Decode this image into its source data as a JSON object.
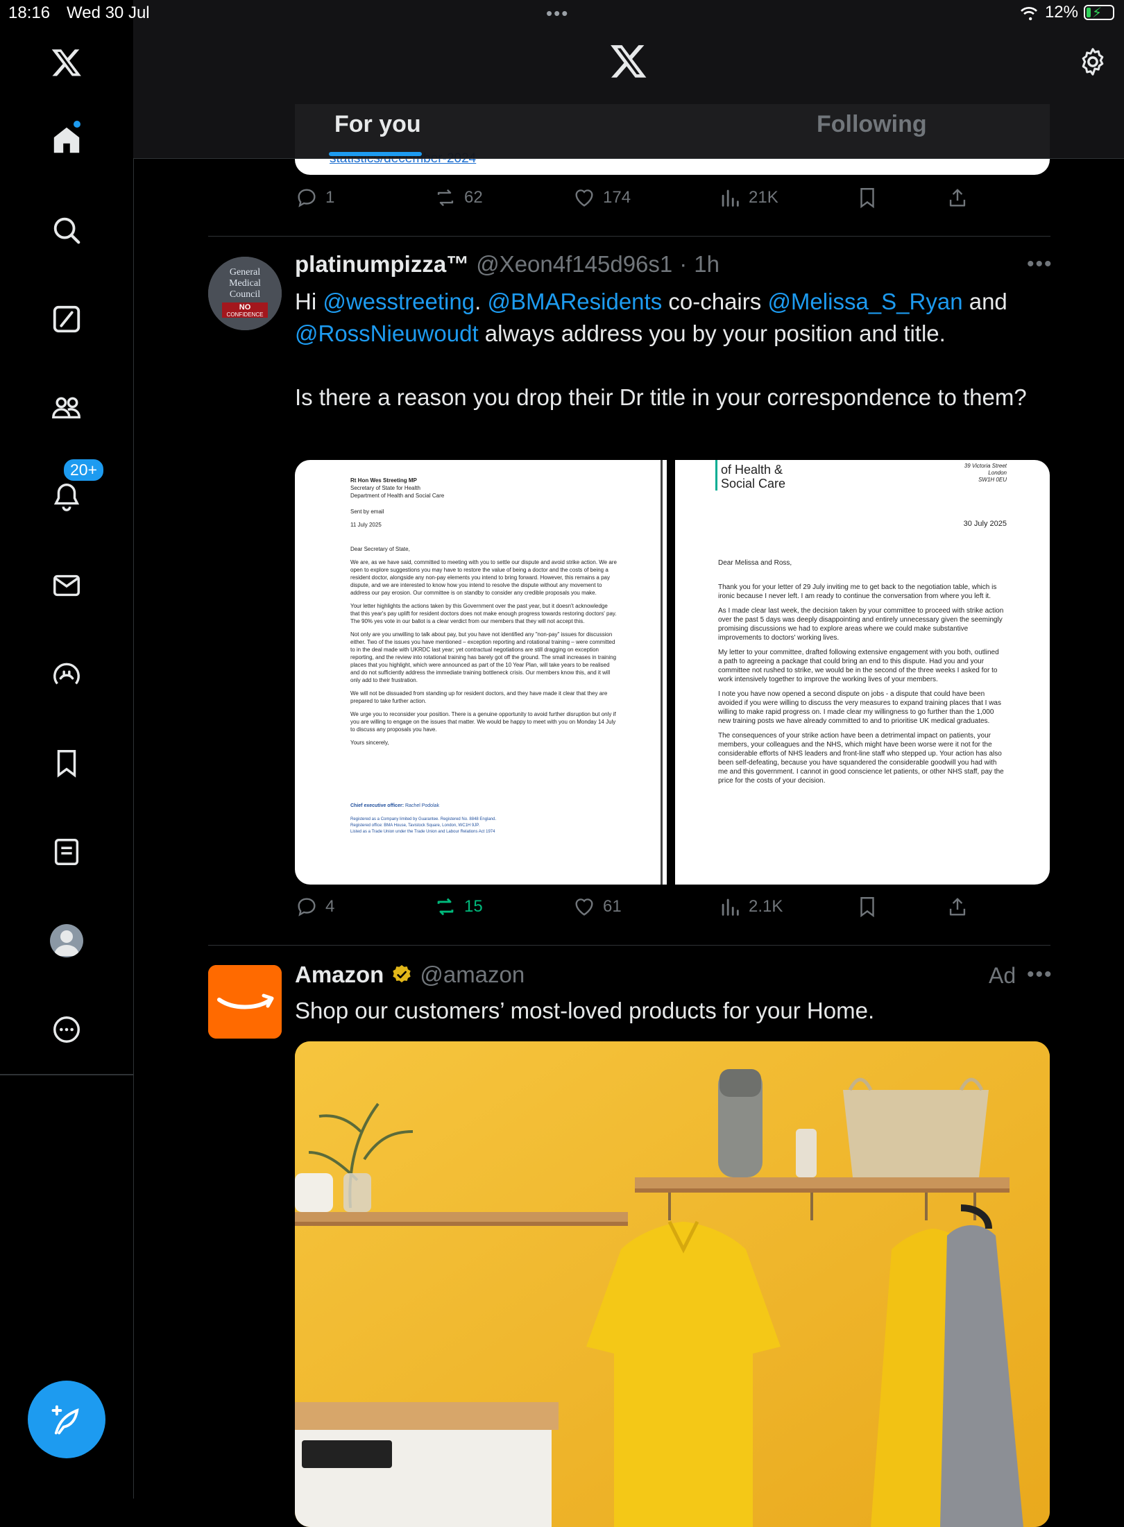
{
  "status_bar": {
    "time": "18:16",
    "date": "Wed 30 Jul",
    "battery": "12%"
  },
  "sidebar": {
    "notif_badge": "20+",
    "items": [
      "home",
      "explore",
      "grok",
      "communities",
      "notifications",
      "messages",
      "spaces",
      "bookmarks",
      "lists",
      "profile",
      "more"
    ]
  },
  "topbar": {
    "tab_foryou": "For you",
    "tab_following": "Following"
  },
  "prev_tweet": {
    "link": "statistics/december-2024",
    "replies": "1",
    "reposts": "62",
    "likes": "174",
    "views": "21K"
  },
  "tweet1": {
    "avatar_text": [
      "General",
      "Medical",
      "Council",
      "NO",
      "CONFIDENCE"
    ],
    "name": "platinumpizza™",
    "handle": "@Xeon4f145d96s1",
    "sep": "·",
    "time": "1h",
    "t1": "Hi ",
    "m1": "@wesstreeting",
    "t2": ". ",
    "m2": "@BMAResidents",
    "t3": " co-chairs ",
    "m3": "@Melissa_S_Ryan",
    "t4": " and ",
    "m4": "@RossNieuwoudt",
    "t5": " always address you by your position and title.",
    "p2": "Is there a reason you drop their Dr title in your correspondence to them?",
    "replies": "4",
    "reposts": "15",
    "likes": "61",
    "views": "2.1K",
    "doc_left": {
      "addressee": [
        "Rt Hon Wes Streeting MP",
        "Secretary of State for Health",
        "Department of Health and Social Care"
      ],
      "sent": "Sent by email",
      "date": "11 July 2025",
      "greeting": "Dear Secretary of State,",
      "paras": [
        "We are, as we have said, committed to meeting with you to settle our dispute and avoid strike action. We are open to explore suggestions you may have to restore the value of being a doctor and the costs of being a resident doctor, alongside any non-pay elements you intend to bring forward. However, this remains a pay dispute, and we are interested to know how you intend to resolve the dispute without any movement to address our pay erosion. Our committee is on standby to consider any credible proposals you make.",
        "Your letter highlights the actions taken by this Government over the past year, but it doesn't acknowledge that this year's pay uplift for resident doctors does not make enough progress towards restoring doctors' pay. The 90% yes vote in our ballot is a clear verdict from our members that they will not accept this.",
        "Not only are you unwilling to talk about pay, but you have not identified any \"non-pay\" issues for discussion either. Two of the issues you have mentioned – exception reporting and rotational training – were committed to in the deal made with UKRDC last year; yet contractual negotiations are still dragging on exception reporting, and the review into rotational training has barely got off the ground. The small increases in training places that you highlight, which were announced as part of the 10 Year Plan, will take years to be realised and do not sufficiently address the immediate training bottleneck crisis. Our members know this, and it will only add to their frustration.",
        "We will not be dissuaded from standing up for resident doctors, and they have made it clear that they are prepared to take further action.",
        "We urge you to reconsider your position. There is a genuine opportunity to avoid further disruption but only if you are willing to engage on the issues that matter. We would be happy to meet with you on Monday 14 July to discuss any proposals you have."
      ],
      "signoff": "Yours sincerely,",
      "footer_label": "Chief executive officer:",
      "footer_name": "Rachel Podolak",
      "footer1": "Registered as a Company limited by Guarantee. Registered No. 8848 England.",
      "footer2": "Registered office: BMA House, Tavistock Square, London, WC1H 9JP.",
      "footer3": "Listed as a Trade Union under the Trade Union and Labour Relations Act 1974"
    },
    "doc_right": {
      "dept1": "of Health &",
      "dept2": "Social Care",
      "address": [
        "39 Victoria Street",
        "London",
        "SW1H 0EU"
      ],
      "date": "30 July 2025",
      "greeting": "Dear Melissa and Ross,",
      "paras": [
        "Thank you for your letter of 29 July inviting me to get back to the negotiation table, which is ironic because I never left. I am ready to continue the conversation from where you left it.",
        "As I made clear last week, the decision taken by your committee to proceed with strike action over the past 5 days was deeply disappointing and entirely unnecessary given the seemingly promising discussions we had to explore areas where we could make substantive improvements to doctors' working lives.",
        "My letter to your committee, drafted following extensive engagement with you both, outlined a path to agreeing a package that could bring an end to this dispute. Had you and your committee not rushed to strike, we would be in the second of the three weeks I asked for to work intensively together to improve the working lives of your members.",
        "I note you have now opened a second dispute on jobs - a dispute that could have been avoided if you were willing to discuss the very measures to expand training places that I was willing to make rapid progress on. I made clear my willingness to go further than the 1,000 new training posts we have already committed to and to prioritise UK medical graduates.",
        "The consequences of your strike action have been a detrimental impact on patients, your members, your colleagues and the NHS, which might have been worse were it not for the considerable efforts of NHS leaders and front-line staff who stepped up. Your action has also been self-defeating, because you have squandered the considerable goodwill you had with me and this government. I cannot in good conscience let patients, or other NHS staff, pay the price for the costs of your decision."
      ]
    }
  },
  "ad": {
    "name": "Amazon",
    "handle": "@amazon",
    "label": "Ad",
    "text": "Shop our customers’ most-loved products for your Home."
  },
  "colors": {
    "accent": "#1d9bf0",
    "repost_active": "#00ba7c",
    "amazon": "#ff6a00",
    "muted": "#71767b"
  }
}
